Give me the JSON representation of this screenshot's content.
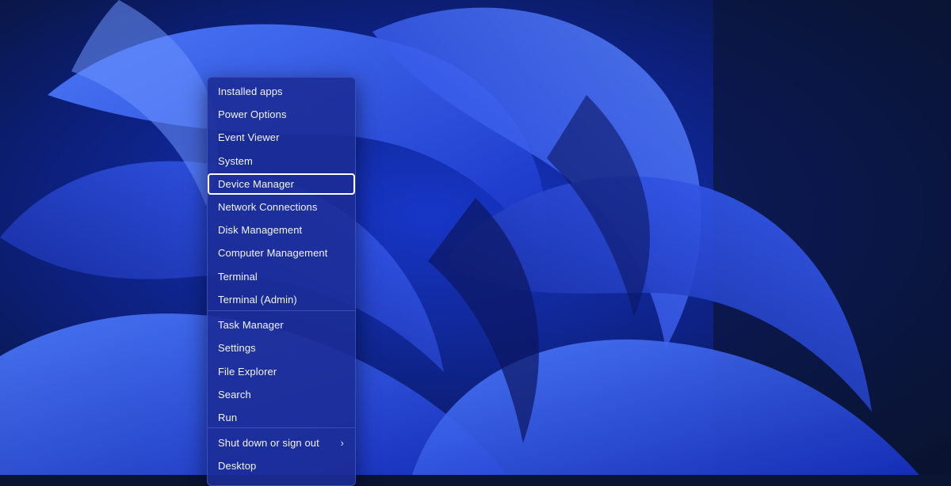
{
  "menu": {
    "items": [
      {
        "label": "Installed apps"
      },
      {
        "label": "Power Options"
      },
      {
        "label": "Event Viewer"
      },
      {
        "label": "System"
      },
      {
        "label": "Device Manager",
        "focused": true
      },
      {
        "label": "Network Connections"
      },
      {
        "label": "Disk Management"
      },
      {
        "label": "Computer Management"
      },
      {
        "label": "Terminal"
      },
      {
        "label": "Terminal (Admin)"
      },
      {
        "label": "Task Manager"
      },
      {
        "label": "Settings"
      },
      {
        "label": "File Explorer"
      },
      {
        "label": "Search"
      },
      {
        "label": "Run"
      },
      {
        "label": "Shut down or sign out",
        "submenu_icon": "chevron-right-icon"
      },
      {
        "label": "Desktop"
      }
    ]
  },
  "colors": {
    "menu_background": "#1c2c96",
    "focus_outline": "#ffffff",
    "text": "#f2f4ff",
    "wallpaper_dark": "#0a1433",
    "wallpaper_accent": "#2f55ff"
  }
}
